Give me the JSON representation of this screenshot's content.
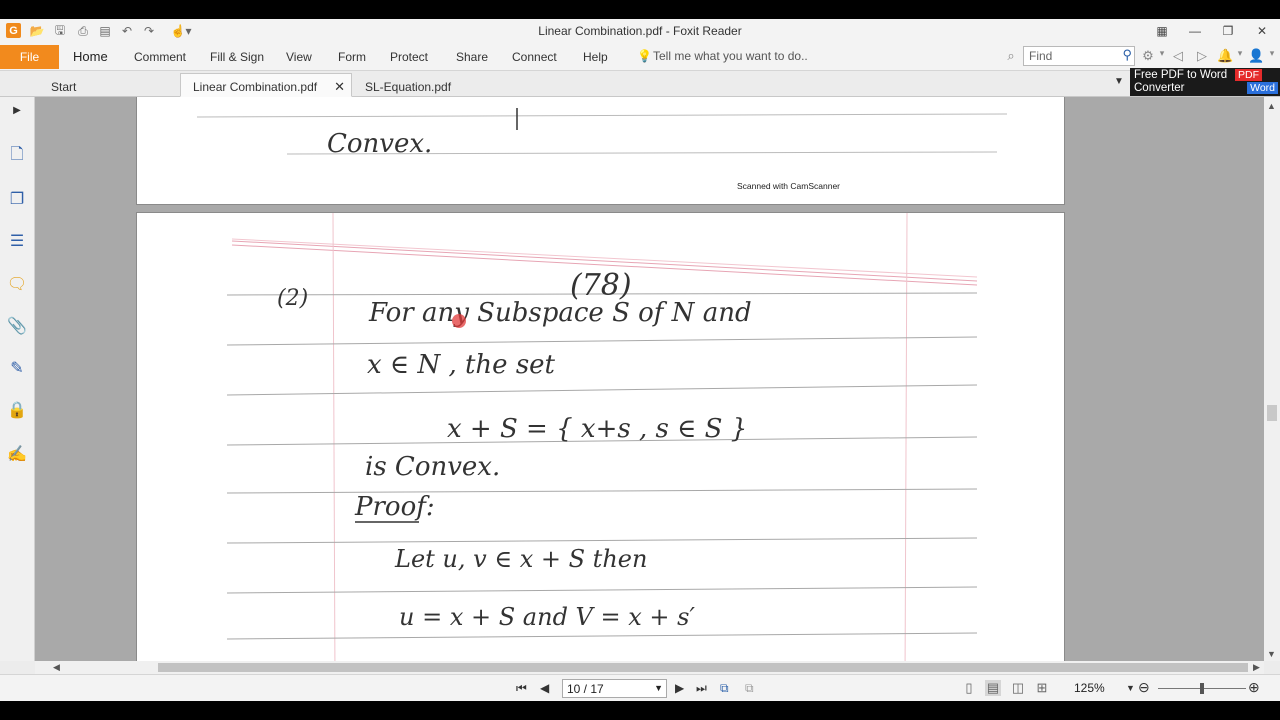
{
  "window": {
    "title": "Linear Combination.pdf - Foxit Reader"
  },
  "ribbon": {
    "file_label": "File",
    "tabs": [
      "Home",
      "Comment",
      "Fill & Sign",
      "View",
      "Form",
      "Protect",
      "Share",
      "Connect",
      "Help"
    ],
    "active_tab": "Home",
    "tell_me_placeholder": "Tell me what you want to do..",
    "find_placeholder": "Find"
  },
  "doc_tabs": {
    "items": [
      "Start",
      "Linear Combination.pdf",
      "SL-Equation.pdf"
    ],
    "active": "Linear Combination.pdf"
  },
  "promo": {
    "line1": "Free PDF to Word",
    "line2": "Converter",
    "badge_pdf": "PDF",
    "badge_word": "Word"
  },
  "document": {
    "scan_footer": "Scanned with CamScanner",
    "page1_text": "Convex.",
    "handwriting": {
      "page_number": "(78)",
      "item_number": "(2)",
      "line1": "For any Subspace S of N and",
      "line2": "x ∈ N , the set",
      "line3": "x + S = { x+s , s ∈ S }",
      "line4": "is Convex.",
      "line5": "Proof:",
      "line6": "Let  u, v ∈ x + S  then",
      "line7": "u = x + S    and  V = x + s′"
    }
  },
  "status": {
    "page_indicator": "10 / 17",
    "zoom": "125%"
  },
  "colors": {
    "accent_orange": "#f28a1d",
    "promo_pdf_red": "#e52b2b",
    "promo_word_blue": "#2a6fdb"
  }
}
